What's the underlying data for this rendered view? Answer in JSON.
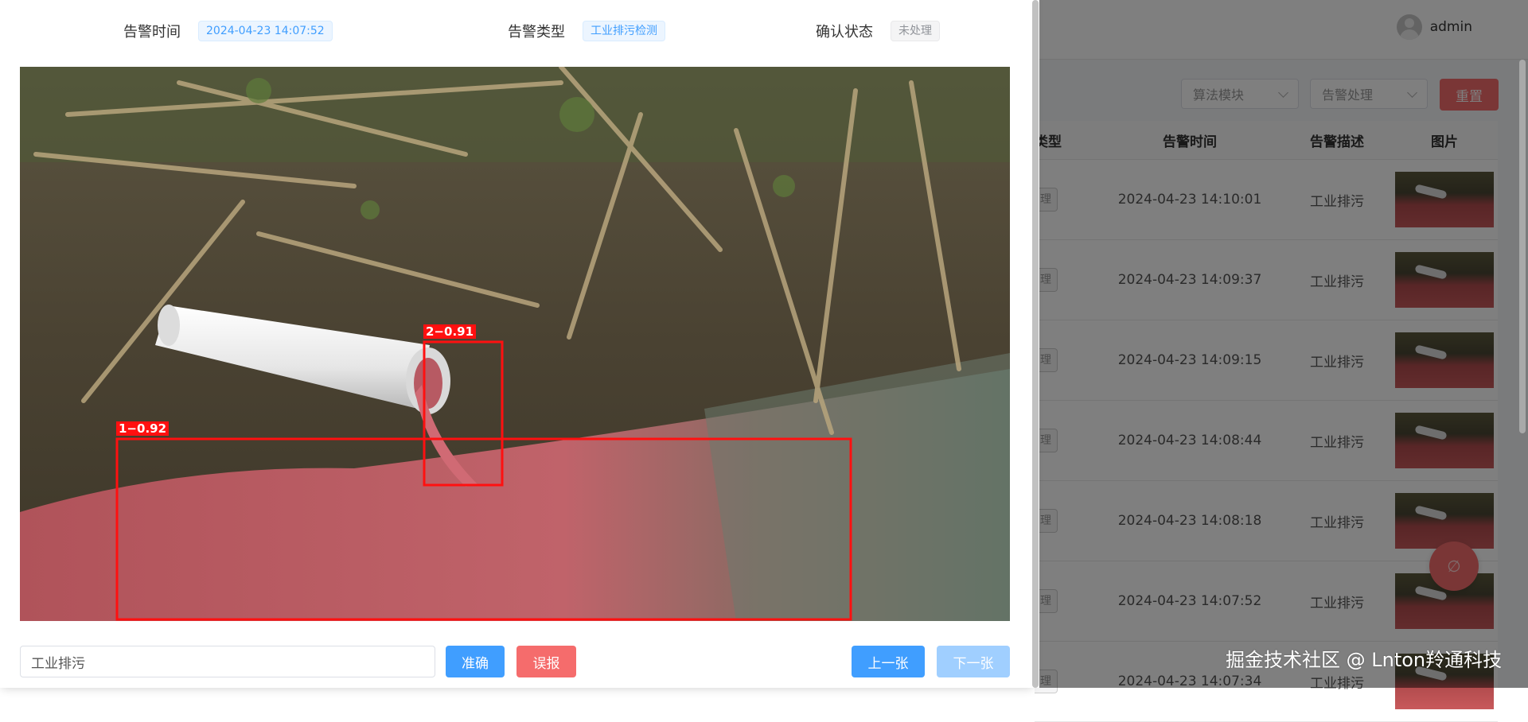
{
  "background": {
    "user": {
      "name": "admin"
    },
    "filters": {
      "algorithm_module": "算法模块",
      "alarm_handling": "告警处理",
      "reset_label": "重置"
    },
    "table": {
      "headers": [
        "类型",
        "告警时间",
        "告警描述",
        "图片"
      ],
      "status_tag": "理",
      "rows": [
        {
          "time": "2024-04-23 14:10:01",
          "desc": "工业排污"
        },
        {
          "time": "2024-04-23 14:09:37",
          "desc": "工业排污"
        },
        {
          "time": "2024-04-23 14:09:15",
          "desc": "工业排污"
        },
        {
          "time": "2024-04-23 14:08:44",
          "desc": "工业排污"
        },
        {
          "time": "2024-04-23 14:08:18",
          "desc": "工业排污"
        },
        {
          "time": "2024-04-23 14:07:52",
          "desc": "工业排污"
        },
        {
          "time": "2024-04-23 14:07:34",
          "desc": "工业排污"
        }
      ]
    },
    "float_button_icon": "∅"
  },
  "dialog": {
    "alarm_time_label": "告警时间",
    "alarm_time": "2024-04-23 14:07:52",
    "alarm_type_label": "告警类型",
    "alarm_type": "工业排污检测",
    "confirm_status_label": "确认状态",
    "confirm_status": "未处理",
    "detections": [
      {
        "label": "1−0.92"
      },
      {
        "label": "2−0.91"
      }
    ],
    "note_value": "工业排污",
    "buttons": {
      "correct": "准确",
      "false_alarm": "误报",
      "prev": "上一张",
      "next": "下一张"
    }
  },
  "watermark": "掘金技术社区 @ Lnton羚通科技",
  "colors": {
    "primary": "#409eff",
    "danger": "#f56c6c",
    "detection_box": "#ff1010"
  }
}
